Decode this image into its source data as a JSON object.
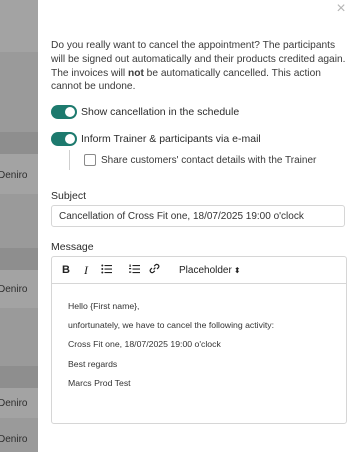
{
  "backdrop": {
    "rows": [
      "Deniro",
      "Deniro",
      "Deniro",
      "Deniro"
    ]
  },
  "dialog": {
    "close_glyph": "×",
    "warning_before": "Do you really want to cancel the appointment? The participants will be signed out automatically and their products credited again. The invoices will ",
    "warning_bold": "not",
    "warning_after": " be automatically cancelled. This action cannot be undone.",
    "toggle_schedule_label": "Show cancellation in the schedule",
    "toggle_schedule_on": true,
    "toggle_inform_label": "Inform Trainer & participants via e-mail",
    "toggle_inform_on": true,
    "share_contact_label": "Share customers' contact details with the Trainer",
    "share_contact_checked": false,
    "subject_label": "Subject",
    "subject_value": "Cancellation of Cross Fit one, 18/07/2025 19:00 o'clock",
    "message_label": "Message",
    "toolbar": {
      "bold": "B",
      "italic": "I",
      "bullet_list_icon": "bullet-list-icon",
      "numbered_list_icon": "numbered-list-icon",
      "link_icon": "link-icon",
      "placeholder_select": "Placeholder"
    },
    "message_lines": [
      "Hello {First name},",
      "unfortunately, we have to cancel the following activity:",
      "Cross Fit one, 18/07/2025 19:00 o'clock",
      "Best regards",
      "Marcs Prod Test"
    ],
    "accent_color": "#1d7a6e"
  }
}
